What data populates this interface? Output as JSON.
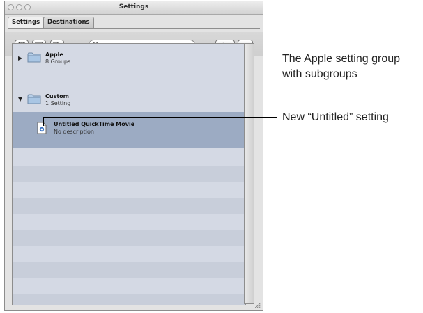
{
  "window": {
    "title": "Settings",
    "tabs": [
      {
        "label": "Settings",
        "active": true
      },
      {
        "label": "Destinations",
        "active": false
      }
    ]
  },
  "toolbar": {
    "buttons": [
      "new-group-icon",
      "destination-icon",
      "duplicate-icon"
    ],
    "search_placeholder": "",
    "add_button_label": "+▾",
    "remove_button_label": "−"
  },
  "list": {
    "items": [
      {
        "title": "Apple",
        "subtitle": "8 Groups",
        "expanded": false,
        "icon": "folder-icon"
      },
      {
        "title": "Custom",
        "subtitle": "1 Setting",
        "expanded": true,
        "icon": "folder-icon"
      },
      {
        "title": "Untitled QuickTime Movie",
        "subtitle": "No description",
        "icon": "quicktime-document-icon",
        "selected": true
      }
    ]
  },
  "callouts": {
    "apple_line1": "The Apple setting group",
    "apple_line2": "with subgroups",
    "untitled": "New “Untitled” setting"
  },
  "colors": {
    "selection": "#9cabc3",
    "list_background": "#d4d9e4",
    "folder": "#a9c6e4"
  }
}
